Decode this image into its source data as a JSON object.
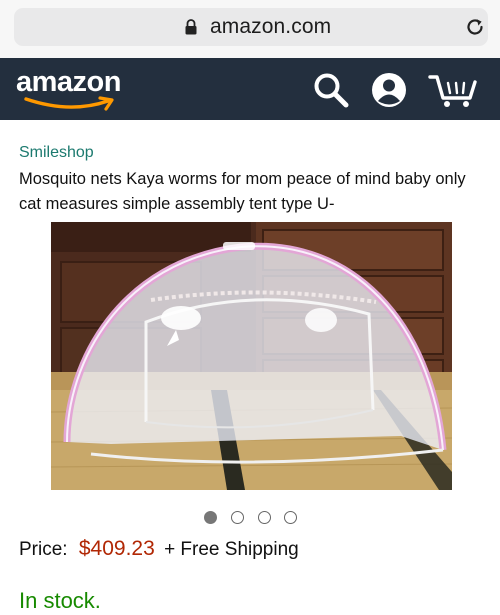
{
  "browser": {
    "url": "amazon.com",
    "lock_icon": "lock-icon",
    "reload_icon": "reload-icon"
  },
  "header": {
    "logo_text": "amazon",
    "background": "#232f3e",
    "icons": [
      "search-icon",
      "account-icon",
      "cart-icon"
    ]
  },
  "product": {
    "seller": "Smileshop",
    "title": "Mosquito nets Kaya worms for mom peace of mind baby only cat measures simple assembly tent type U-",
    "image_count": 4,
    "active_image": 1,
    "price_label": "Price:",
    "price": "$409.23",
    "shipping": "+ Free Shipping",
    "availability": "In stock.",
    "colors": {
      "seller_link": "#1c7a6f",
      "price": "#b12704",
      "in_stock": "#178a00"
    }
  }
}
